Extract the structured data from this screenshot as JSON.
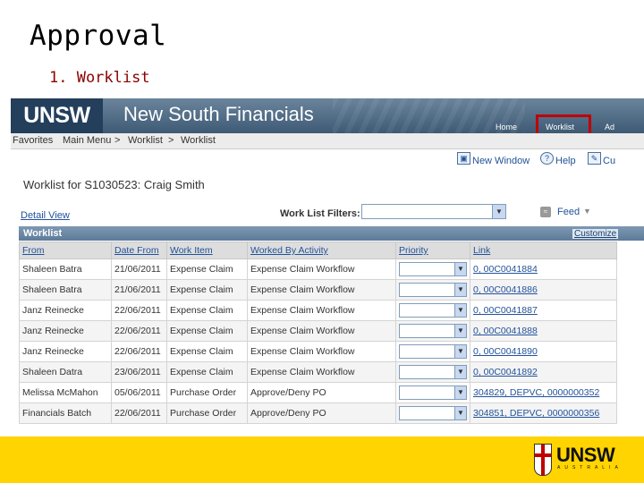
{
  "slide": {
    "title": "Approval",
    "subtitle": "1. Worklist"
  },
  "app": {
    "brand": "UNSW",
    "name": "New South Financials",
    "topnav": [
      "Home",
      "Worklist",
      "Ad"
    ]
  },
  "menubar": [
    "Favorites",
    "Main Menu",
    ">",
    "Worklist",
    ">",
    "Worklist"
  ],
  "toolbar": {
    "new_window": "New Window",
    "help": "Help",
    "customize": "Cu"
  },
  "page": {
    "heading": "Worklist for S1030523: Craig Smith",
    "detail_view": "Detail View",
    "filters_label": "Work List Filters:",
    "filter_value": "",
    "feed": "Feed"
  },
  "grid": {
    "title": "Worklist",
    "customize": "Customize",
    "columns": [
      "From",
      "Date From",
      "Work Item",
      "Worked By Activity",
      "Priority",
      "Link"
    ],
    "rows": [
      {
        "from": "Shaleen Batra",
        "date": "21/06/2011",
        "item": "Expense Claim",
        "activity": "Expense Claim Workflow",
        "priority": "",
        "link": "0, 00C0041884"
      },
      {
        "from": "Shaleen Batra",
        "date": "21/06/2011",
        "item": "Expense Claim",
        "activity": "Expense Claim Workflow",
        "priority": "",
        "link": "0, 00C0041886"
      },
      {
        "from": "Janz Reinecke",
        "date": "22/06/2011",
        "item": "Expense Claim",
        "activity": "Expense Claim Workflow",
        "priority": "",
        "link": "0, 00C0041887"
      },
      {
        "from": "Janz Reinecke",
        "date": "22/06/2011",
        "item": "Expense Claim",
        "activity": "Expense Claim Workflow",
        "priority": "",
        "link": "0, 00C0041888"
      },
      {
        "from": "Janz Reinecke",
        "date": "22/06/2011",
        "item": "Expense Claim",
        "activity": "Expense Claim Workflow",
        "priority": "",
        "link": "0, 00C0041890"
      },
      {
        "from": "Shaleen Datra",
        "date": "23/06/2011",
        "item": "Expense Claim",
        "activity": "Expense Claim Workflow",
        "priority": "",
        "link": "0, 00C0041892"
      },
      {
        "from": "Melissa McMahon",
        "date": "05/06/2011",
        "item": "Purchase Order",
        "activity": "Approve/Deny PO",
        "priority": "",
        "link": "304829, DEPVC, 0000000352"
      },
      {
        "from": "Financials Batch",
        "date": "22/06/2011",
        "item": "Purchase Order",
        "activity": "Approve/Deny PO",
        "priority": "",
        "link": "304851, DEPVC, 0000000356"
      }
    ]
  },
  "footer": {
    "logo": "UNSW",
    "sub": "AUSTRALIA"
  },
  "colors": {
    "highlight": "#c00000",
    "footer_bar": "#ffd400",
    "banner": "#3e5a74",
    "link": "#22529a"
  },
  "icons": [
    "new-window-icon",
    "help-icon",
    "customize-icon",
    "feed-icon",
    "dropdown-arrow-icon",
    "unsw-crest-icon"
  ]
}
